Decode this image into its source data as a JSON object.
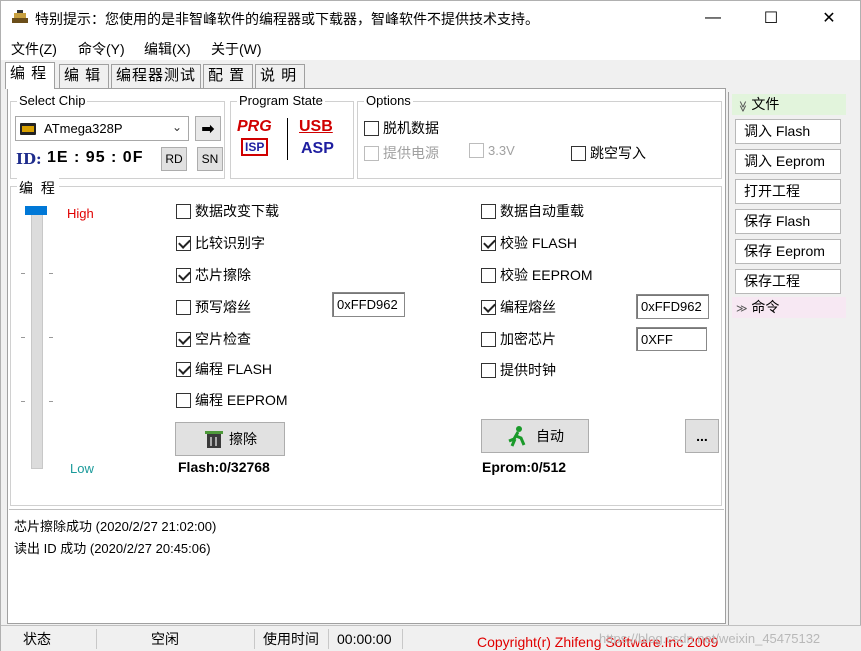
{
  "window": {
    "title": "特别提示：您使用的是非智峰软件的编程器或下载器，智峰软件不提供技术支持。",
    "minimize": "—",
    "maximize": "☐",
    "close": "✕"
  },
  "menu": [
    "文件(Z)",
    "命令(Y)",
    "编辑(X)",
    "关于(W)"
  ],
  "tabs": [
    "编 程",
    "编 辑",
    "编程器测试",
    "配 置",
    "说 明"
  ],
  "select_chip": {
    "label": "Select Chip",
    "value": "ATmega328P",
    "arrow": "⌄",
    "go": "➡"
  },
  "id": {
    "label": "ID:",
    "value": "1E : 95 : 0F",
    "rd": "RD",
    "sn": "SN"
  },
  "program_state": {
    "label": "Program State",
    "prg": "PRG",
    "isp": "ISP",
    "usb": "USB",
    "asp": "ASP"
  },
  "options": {
    "label": "Options",
    "offline": "脱机数据",
    "power": "提供电源",
    "v33": "3.3V",
    "skip": "跳空写入"
  },
  "program": {
    "label": "编 程",
    "high": "High",
    "low": "Low",
    "left_checks": [
      {
        "label": "数据改变下载",
        "checked": false
      },
      {
        "label": "比较识别字",
        "checked": true
      },
      {
        "label": "芯片擦除",
        "checked": true
      },
      {
        "label": "预写熔丝",
        "checked": false
      },
      {
        "label": "空片检查",
        "checked": true
      },
      {
        "label": "编程 FLASH",
        "checked": true
      },
      {
        "label": "编程 EEPROM",
        "checked": false
      }
    ],
    "right_checks": [
      {
        "label": "数据自动重载",
        "checked": false
      },
      {
        "label": "校验 FLASH",
        "checked": true
      },
      {
        "label": "校验 EEPROM",
        "checked": false
      },
      {
        "label": "编程熔丝",
        "checked": true
      },
      {
        "label": "加密芯片",
        "checked": false
      },
      {
        "label": "提供时钟",
        "checked": false
      }
    ],
    "prefuse_value": "0xFFD962",
    "fuse_value": "0xFFD962",
    "lock_value": "0XFF",
    "erase_button": "擦除",
    "auto_button": "自动",
    "more_button": "...",
    "flash_count": "Flash:0/32768",
    "eprom_count": "Eprom:0/512"
  },
  "log": [
    {
      "text": "芯片擦除成功",
      "time": "(2020/2/27 21:02:00)"
    },
    {
      "text": "读出 ID 成功",
      "time": "(2020/2/27 20:45:06)"
    }
  ],
  "side": {
    "file_head": "文件",
    "file_buttons": [
      "调入 Flash",
      "调入 Eeprom",
      "打开工程",
      "保存 Flash",
      "保存 Eeprom",
      "保存工程"
    ],
    "command_head": "命令",
    "expand_icon": "≫",
    "collapse_icon": "≫"
  },
  "status": {
    "state_label": "状态",
    "state_value": "空闲",
    "time_label": "使用时间",
    "time_value": "00:00:00",
    "copyright": "Copyright(r) Zhifeng Software.Inc 2009",
    "watermark": "https://blog.csdn.net/weixin_45475132"
  }
}
